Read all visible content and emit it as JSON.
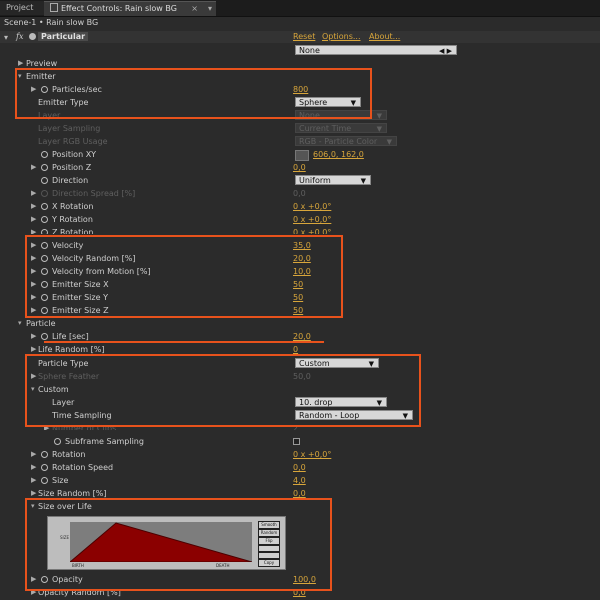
{
  "tabs": {
    "project": "Project",
    "effect_controls": "Effect Controls: Rain slow BG"
  },
  "breadcrumb": "Scene-1 • Rain slow BG",
  "effect": {
    "fx": "fx",
    "name": "Particular",
    "reset": "Reset",
    "options": "Options...",
    "about": "About..."
  },
  "preset": "None",
  "rows": {
    "preview": "Preview",
    "emitter": "Emitter",
    "particles_sec": {
      "label": "Particles/sec",
      "value": "800"
    },
    "emitter_type": {
      "label": "Emitter Type",
      "value": "Sphere"
    },
    "layer": {
      "label": "Layer",
      "value": "None"
    },
    "layer_sampling": {
      "label": "Layer Sampling",
      "value": "Current Time"
    },
    "layer_rgb": {
      "label": "Layer RGB Usage",
      "value": "RGB - Particle Color"
    },
    "position_xy": {
      "label": "Position XY",
      "value": "606,0, 162,0"
    },
    "position_z": {
      "label": "Position Z",
      "value": "0,0"
    },
    "direction": {
      "label": "Direction",
      "value": "Uniform"
    },
    "direction_spread": {
      "label": "Direction Spread [%]",
      "value": "0,0"
    },
    "x_rotation": {
      "label": "X Rotation",
      "value": "0 x +0,0°"
    },
    "y_rotation": {
      "label": "Y Rotation",
      "value": "0 x +0,0°"
    },
    "z_rotation": {
      "label": "Z Rotation",
      "value": "0 x +0,0°"
    },
    "velocity": {
      "label": "Velocity",
      "value": "35,0"
    },
    "velocity_random": {
      "label": "Velocity Random [%]",
      "value": "20,0"
    },
    "velocity_motion": {
      "label": "Velocity from Motion [%]",
      "value": "10,0"
    },
    "emitter_size_x": {
      "label": "Emitter Size X",
      "value": "50"
    },
    "emitter_size_y": {
      "label": "Emitter Size Y",
      "value": "50"
    },
    "emitter_size_z": {
      "label": "Emitter Size Z",
      "value": "50"
    },
    "particle": "Particle",
    "life": {
      "label": "Life [sec]",
      "value": "20,0"
    },
    "life_random": {
      "label": "Life Random [%]",
      "value": "0"
    },
    "particle_type": {
      "label": "Particle Type",
      "value": "Custom"
    },
    "sphere_feather": {
      "label": "Sphere Feather",
      "value": "50,0"
    },
    "custom": "Custom",
    "custom_layer": {
      "label": "Layer",
      "value": "10. drop"
    },
    "time_sampling": {
      "label": "Time Sampling",
      "value": "Random - Loop"
    },
    "number_of_clips": {
      "label": "Number of Clips",
      "value": "2"
    },
    "subframe_sampling": {
      "label": "Subframe Sampling"
    },
    "rotation": {
      "label": "Rotation",
      "value": "0 x +0,0°"
    },
    "rotation_speed": {
      "label": "Rotation Speed",
      "value": "0,0"
    },
    "size": {
      "label": "Size",
      "value": "4,0"
    },
    "size_random": {
      "label": "Size Random [%]",
      "value": "0,0"
    },
    "size_over_life": "Size over Life",
    "opacity": {
      "label": "Opacity",
      "value": "100,0"
    },
    "opacity_random": {
      "label": "Opacity Random [%]",
      "value": "0,0"
    }
  },
  "graph": {
    "y_label": "SIZE",
    "x_start": "BIRTH",
    "x_end": "DEATH",
    "buttons": [
      "Smooth",
      "Random",
      "Flip",
      "Copy"
    ]
  },
  "colors": {
    "accent_value": "#d8a63b",
    "highlight": "#e8521c",
    "curve_fill": "#8b0000"
  }
}
